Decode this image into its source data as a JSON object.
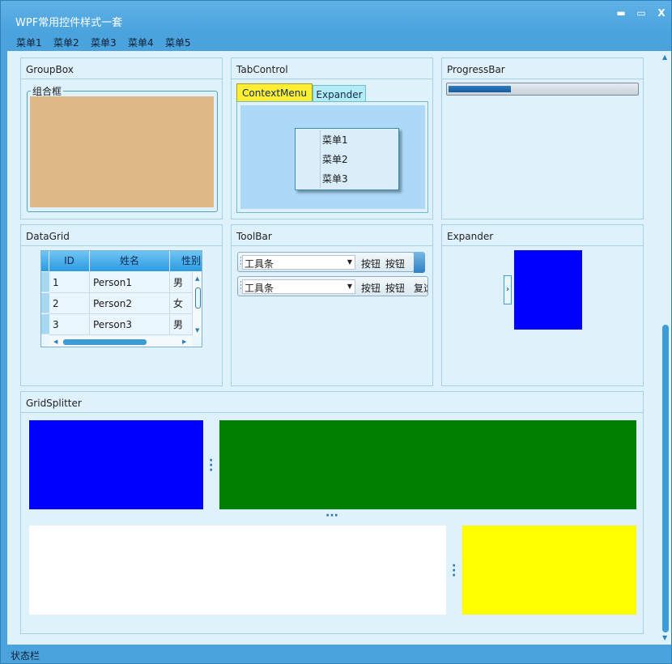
{
  "window": {
    "title": "WPF常用控件样式一套",
    "buttons": {
      "minimize": "▬",
      "maximize": "▭",
      "close": "X"
    }
  },
  "menubar": {
    "items": [
      "菜单1",
      "菜单2",
      "菜单3",
      "菜单4",
      "菜单5"
    ]
  },
  "panels": {
    "groupbox": {
      "title": "GroupBox",
      "legend": "组合框",
      "fill_color": "#deb887"
    },
    "tabcontrol": {
      "title": "TabControl",
      "tabs": [
        "ContextMenu",
        "Expander"
      ],
      "selected_tab": "ContextMenu",
      "context_menu": {
        "items": [
          "菜单1",
          "菜单2",
          "菜单3"
        ]
      }
    },
    "progressbar": {
      "title": "ProgressBar",
      "value_percent": 33
    },
    "datagrid": {
      "title": "DataGrid",
      "columns": [
        "ID",
        "姓名",
        "性别"
      ],
      "rows": [
        [
          "1",
          "Person1",
          "男"
        ],
        [
          "2",
          "Person2",
          "女"
        ],
        [
          "3",
          "Person3",
          "男"
        ]
      ]
    },
    "toolbar": {
      "title": "ToolBar",
      "toolbars": [
        {
          "combo_label": "工具条",
          "buttons": [
            "按钮",
            "按钮"
          ]
        },
        {
          "combo_label": "工具条",
          "buttons": [
            "按钮",
            "按钮",
            "复选"
          ]
        }
      ]
    },
    "expander": {
      "title": "Expander",
      "content_color": "#0000ff"
    },
    "gridsplitter": {
      "title": "GridSplitter",
      "colors": {
        "top_left": "#0000ff",
        "top_right": "#008000",
        "bottom_left": "#ffffff",
        "bottom_right": "#ffff00"
      }
    }
  },
  "statusbar": {
    "text": "状态栏"
  }
}
